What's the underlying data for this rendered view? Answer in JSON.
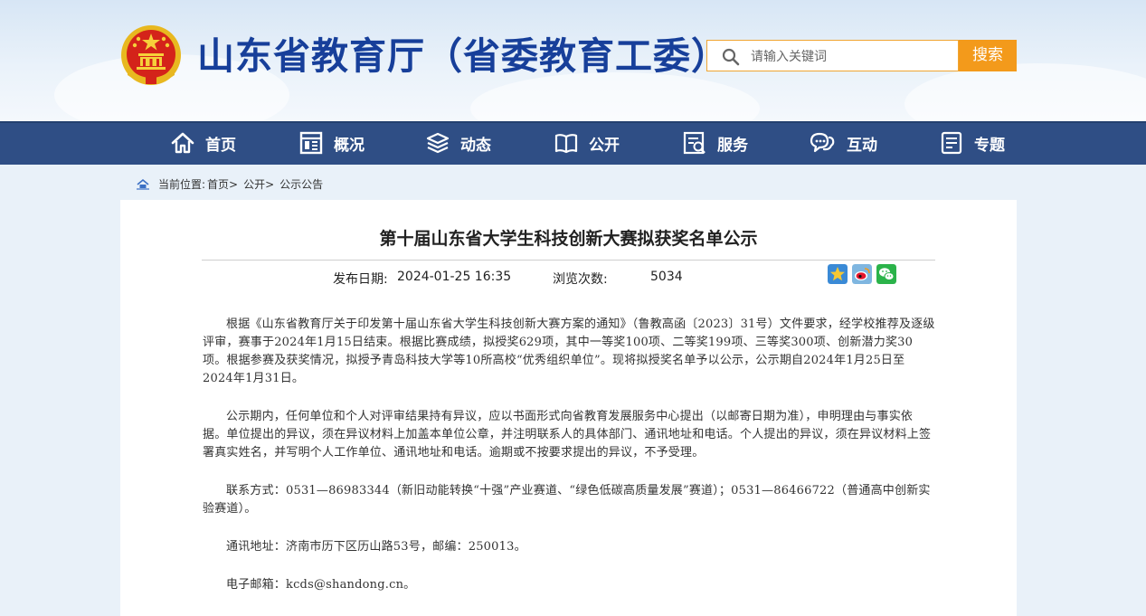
{
  "site": {
    "title": "山东省教育厅（省委教育工委）"
  },
  "search": {
    "placeholder": "请输入关键词",
    "button_label": "搜索"
  },
  "nav": {
    "items": [
      {
        "label": "首页",
        "icon": "home-icon"
      },
      {
        "label": "概况",
        "icon": "overview-icon"
      },
      {
        "label": "动态",
        "icon": "layers-icon"
      },
      {
        "label": "公开",
        "icon": "book-icon"
      },
      {
        "label": "服务",
        "icon": "service-icon"
      },
      {
        "label": "互动",
        "icon": "chat-icon"
      },
      {
        "label": "专题",
        "icon": "document-icon"
      }
    ]
  },
  "breadcrumb": {
    "prefix": "当前位置:",
    "items": [
      "首页>",
      "公开>",
      "公示公告"
    ]
  },
  "article": {
    "title": "第十届山东省大学生科技创新大赛拟获奖名单公示",
    "publish_label": "发布日期:",
    "publish_date": "2024-01-25 16:35",
    "views_label": "浏览次数:",
    "views": "5034",
    "share_icons": [
      "favorite-star-icon",
      "weibo-icon",
      "wechat-icon"
    ],
    "paragraphs": [
      "根据《山东省教育厅关于印发第十届山东省大学生科技创新大赛方案的通知》（鲁教高函〔2023〕31号）文件要求，经学校推荐及逐级评审，赛事于2024年1月15日结束。根据比赛成绩，拟授奖629项，其中一等奖100项、二等奖199项、三等奖300项、创新潜力奖30项。根据参赛及获奖情况，拟授予青岛科技大学等10所高校“优秀组织单位”。现将拟授奖名单予以公示，公示期自2024年1月25日至2024年1月31日。",
      "公示期内，任何单位和个人对评审结果持有异议，应以书面形式向省教育发展服务中心提出（以邮寄日期为准），申明理由与事实依据。单位提出的异议，须在异议材料上加盖本单位公章，并注明联系人的具体部门、通讯地址和电话。个人提出的异议，须在异议材料上签署真实姓名，并写明个人工作单位、通讯地址和电话。逾期或不按要求提出的异议，不予受理。",
      "联系方式：0531—86983344（新旧动能转换“十强”产业赛道、“绿色低碳高质量发展”赛道）；0531—86466722（普通高中创新实验赛道）。",
      "通讯地址：济南市历下区历山路53号，邮编：250013。",
      "电子邮箱：kcds@shandong.cn。"
    ]
  },
  "colors": {
    "nav_bg": "#2f4e85",
    "title_blue": "#173f9a",
    "accent_orange": "#f39a1b"
  }
}
